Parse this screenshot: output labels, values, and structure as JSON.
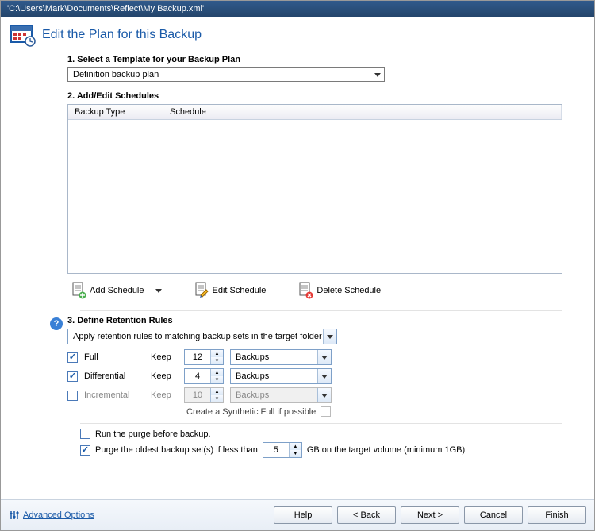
{
  "window": {
    "title": "'C:\\Users\\Mark\\Documents\\Reflect\\My Backup.xml'"
  },
  "page": {
    "title": "Edit the Plan for this Backup"
  },
  "step1": {
    "label": "1. Select a Template for your Backup Plan",
    "value": "Definition backup plan"
  },
  "step2": {
    "label": "2. Add/Edit Schedules",
    "col_backup_type": "Backup Type",
    "col_schedule": "Schedule",
    "add_label": "Add Schedule",
    "edit_label": "Edit Schedule",
    "delete_label": "Delete Schedule"
  },
  "step3": {
    "label": "3. Define Retention Rules",
    "scope_value": "Apply retention rules to matching backup sets in the target folder",
    "keep_label": "Keep",
    "full": {
      "enabled": true,
      "name": "Full",
      "count": "12",
      "unit": "Backups"
    },
    "diff": {
      "enabled": true,
      "name": "Differential",
      "count": "4",
      "unit": "Backups"
    },
    "inc": {
      "enabled": false,
      "name": "Incremental",
      "count": "10",
      "unit": "Backups"
    },
    "synthetic_label": "Create a Synthetic Full if possible",
    "synthetic_checked": false
  },
  "purge": {
    "run_before_label": "Run the purge before backup.",
    "run_before_checked": false,
    "purge_oldest_label": "Purge the oldest backup set(s) if less than",
    "purge_oldest_checked": true,
    "gb_value": "5",
    "gb_suffix": "GB on the target volume (minimum 1GB)"
  },
  "footer": {
    "advanced": "Advanced Options",
    "help": "Help",
    "back": "< Back",
    "next": "Next >",
    "cancel": "Cancel",
    "finish": "Finish"
  }
}
